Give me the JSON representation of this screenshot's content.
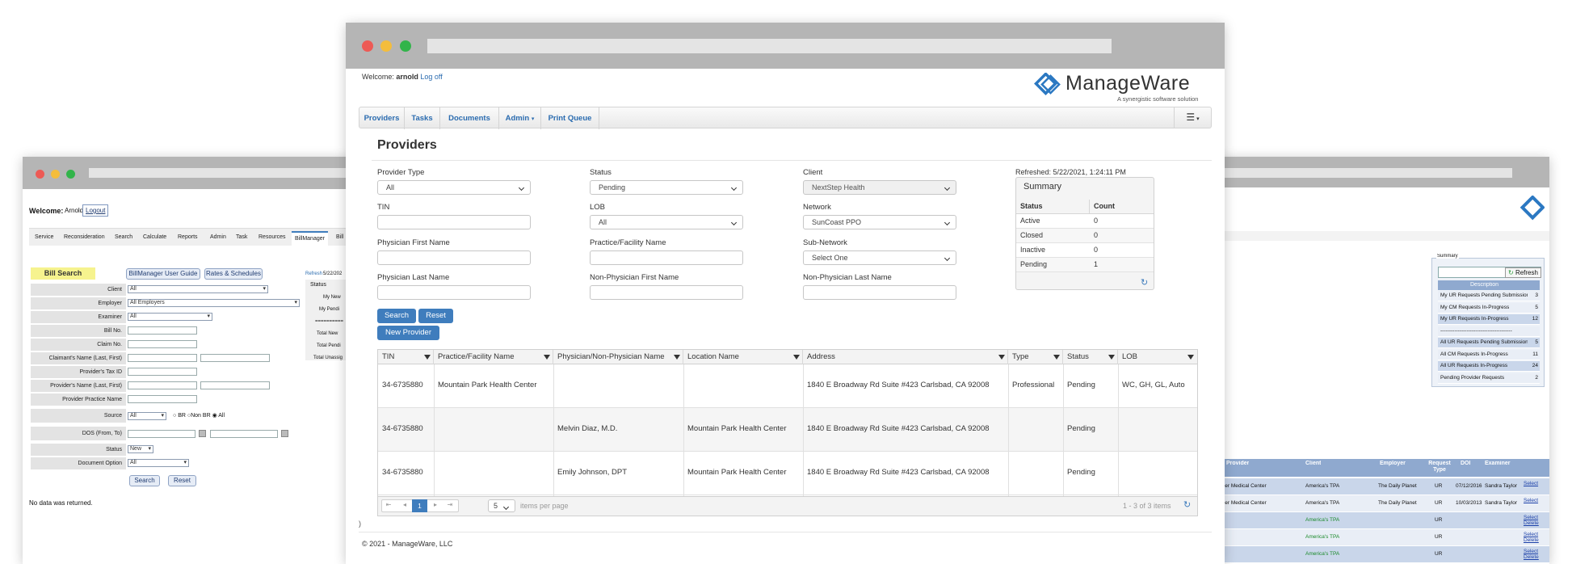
{
  "left_window": {
    "welcome_label": "Welcome:",
    "user": "Arnold",
    "logout": "Logout",
    "nav": [
      "Service",
      "Reconsideration",
      "Search",
      "Calculate",
      "Reports",
      "Admin",
      "Task",
      "Resources",
      "BillManager",
      "Bill"
    ],
    "panel_title": "Bill Search",
    "guide_button": "BillManager User Guide",
    "rates_button": "Rates & Schedules",
    "fields": [
      {
        "label": "Client",
        "value": "All"
      },
      {
        "label": "Employer",
        "value": "All Employers"
      },
      {
        "label": "Examiner",
        "value": "All"
      },
      {
        "label": "Bill No.",
        "value": ""
      },
      {
        "label": "Claim No.",
        "value": ""
      },
      {
        "label": "Claimant's Name (Last, First)",
        "value": ""
      },
      {
        "label": "Provider's Tax ID",
        "value": ""
      },
      {
        "label": "Provider's Name (Last, First)",
        "value": ""
      },
      {
        "label": "Provider Practice Name",
        "value": ""
      },
      {
        "label": "Source",
        "value": "All"
      },
      {
        "label": "DOS (From, To)",
        "value": ""
      },
      {
        "label": "Status",
        "value": "New"
      },
      {
        "label": "Document Option",
        "value": "All"
      }
    ],
    "source_options": [
      "BR",
      "Non BR",
      "All"
    ],
    "search_button": "Search",
    "reset_button": "Reset",
    "no_data": "No data was returned.",
    "side": {
      "refresh": "Refresh",
      "date": "5/22/202",
      "status_header": "Status",
      "rows": [
        "My New",
        "My Pendi",
        "==========",
        "Total New",
        "Total Pendi",
        "Total Unassig"
      ]
    }
  },
  "right_window": {
    "summary_legend": "Summary",
    "refresh_button": "Refresh",
    "description_header": "Description",
    "rows": [
      {
        "desc": "My UR Requests Pending Submission",
        "count": "3"
      },
      {
        "desc": "My CM Requests In-Progress",
        "count": "5"
      },
      {
        "desc": "My UR Requests In-Progress",
        "count": "12"
      },
      {
        "desc": "-----------------------------------------",
        "count": ""
      },
      {
        "desc": "All UR Requests Pending Submission",
        "count": "5"
      },
      {
        "desc": "All CM Requests In-Progress",
        "count": "11"
      },
      {
        "desc": "All UR Requests In-Progress",
        "count": "24"
      },
      {
        "desc": "Pending Provider Requests",
        "count": "2"
      }
    ],
    "grid_headers": [
      "Provider",
      "Client",
      "Employer",
      "Request Type",
      "DOI",
      "Examiner"
    ],
    "grid_rows": [
      {
        "provider": "vider Medical Center",
        "client": "America's TPA",
        "employer": "The Daily Planet",
        "type": "UR",
        "doi": "07/12/2016",
        "examiner": "Sandra Taylor",
        "action": "Select"
      },
      {
        "provider": "vider Medical Center",
        "client": "America's TPA",
        "employer": "The Daily Planet",
        "type": "UR",
        "doi": "10/03/2013",
        "examiner": "Sandra Taylor",
        "action": "Select"
      },
      {
        "provider": "",
        "client": "America's TPA",
        "employer": "",
        "type": "UR",
        "doi": "",
        "examiner": "",
        "action": "Select Delete"
      },
      {
        "provider": "",
        "client": "America's TPA",
        "employer": "",
        "type": "UR",
        "doi": "",
        "examiner": "",
        "action": "Select Delete"
      },
      {
        "provider": "",
        "client": "America's TPA",
        "employer": "",
        "type": "UR",
        "doi": "",
        "examiner": "",
        "action": "Select Delete"
      }
    ]
  },
  "main_window": {
    "welcome_label": "Welcome:",
    "user": "arnold",
    "logout": "Log off",
    "brand": "ManageWare",
    "tagline": "A synergistic software solution",
    "nav": [
      "Providers",
      "Tasks",
      "Documents",
      "Admin",
      "Print Queue"
    ],
    "page_title": "Providers",
    "filters": {
      "provider_type": {
        "label": "Provider Type",
        "value": "All"
      },
      "status": {
        "label": "Status",
        "value": "Pending"
      },
      "client": {
        "label": "Client",
        "value": "NextStep Health"
      },
      "tin": {
        "label": "TIN",
        "value": ""
      },
      "lob": {
        "label": "LOB",
        "value": "All"
      },
      "network": {
        "label": "Network",
        "value": "SunCoast PPO"
      },
      "physician_first": {
        "label": "Physician First Name",
        "value": ""
      },
      "practice": {
        "label": "Practice/Facility Name",
        "value": ""
      },
      "subnetwork": {
        "label": "Sub-Network",
        "value": "Select One"
      },
      "physician_last": {
        "label": "Physician Last Name",
        "value": ""
      },
      "nonphysician_first": {
        "label": "Non-Physician First Name",
        "value": ""
      },
      "nonphysician_last": {
        "label": "Non-Physician Last Name",
        "value": ""
      }
    },
    "refreshed": "Refreshed: 5/22/2021, 1:24:11 PM",
    "summary": {
      "title": "Summary",
      "headers": [
        "Status",
        "Count"
      ],
      "rows": [
        {
          "status": "Active",
          "count": "0"
        },
        {
          "status": "Closed",
          "count": "0"
        },
        {
          "status": "Inactive",
          "count": "0"
        },
        {
          "status": "Pending",
          "count": "1"
        }
      ]
    },
    "search_button": "Search",
    "reset_button": "Reset",
    "new_provider_button": "New Provider",
    "grid": {
      "headers": [
        "TIN",
        "Practice/Facility Name",
        "Physician/Non-Physician Name",
        "Location Name",
        "Address",
        "Type",
        "Status",
        "LOB"
      ],
      "rows": [
        [
          "34-6735880",
          "Mountain Park Health Center",
          "",
          "",
          "1840 E Broadway Rd Suite #423 Carlsbad, CA 92008",
          "Professional",
          "Pending",
          "WC, GH, GL, Auto"
        ],
        [
          "34-6735880",
          "",
          "Melvin Diaz, M.D.",
          "Mountain Park Health Center",
          "1840 E Broadway Rd Suite #423 Carlsbad, CA 92008",
          "",
          "Pending",
          ""
        ],
        [
          "34-6735880",
          "",
          "Emily Johnson, DPT",
          "Mountain Park Health Center",
          "1840 E Broadway Rd Suite #423 Carlsbad, CA 92008",
          "",
          "Pending",
          ""
        ]
      ],
      "pager": {
        "page": "1",
        "page_size": "5",
        "items_per_page": "items per page",
        "info": "1 - 3 of 3 items"
      }
    },
    "stray_text": ")",
    "footer": "© 2021 - ManageWare, LLC"
  },
  "colors": {
    "accent": "#3f7dbd",
    "link": "#2b6cb0",
    "titlebar": "#b5b5b5",
    "red": "#ed5a55",
    "yellow": "#f4bd3c",
    "green": "#32b44a"
  }
}
